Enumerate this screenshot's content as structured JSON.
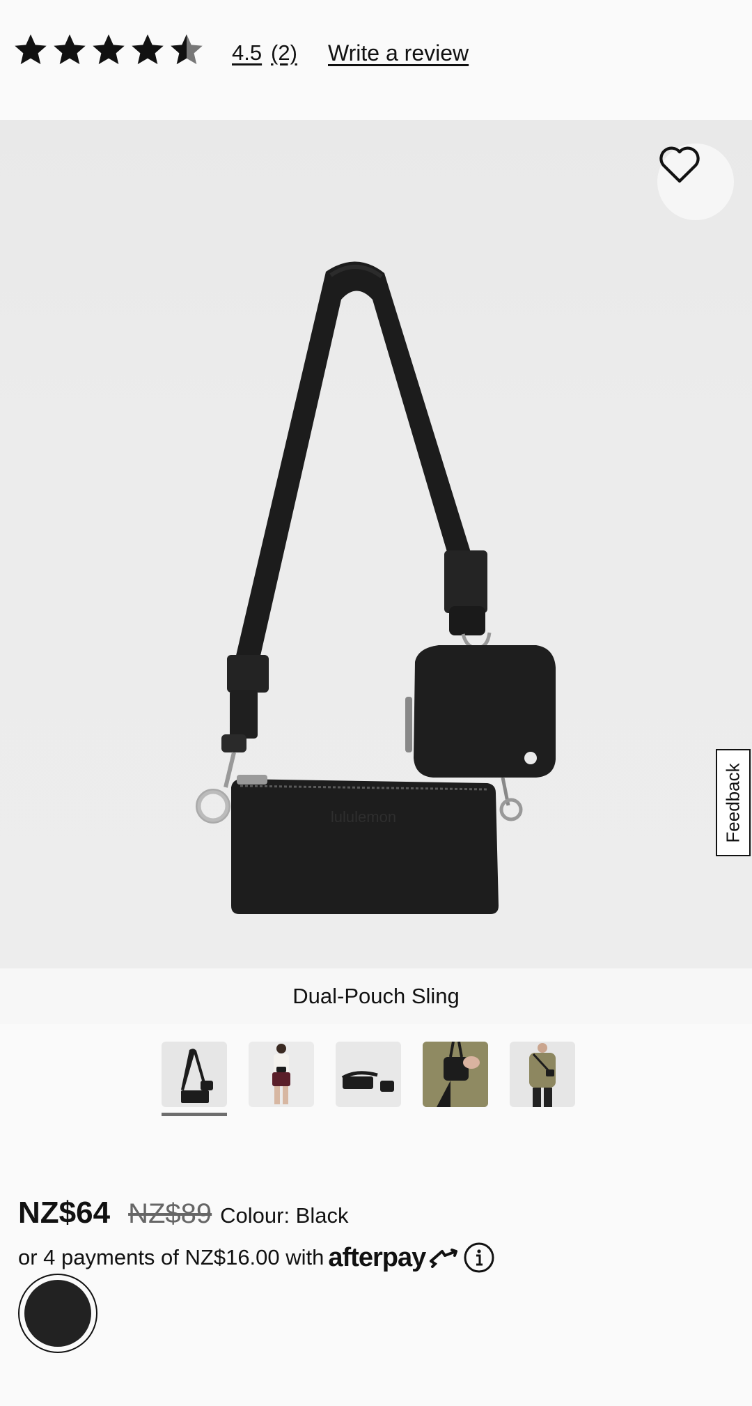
{
  "rating": {
    "value": "4.5",
    "count": "(2)",
    "stars_filled": 4.5,
    "stars_total": 5,
    "write_review": "Write a review"
  },
  "product": {
    "name": "Dual-Pouch Sling",
    "hero_logo_text": "lululemon",
    "thumbnails": [
      "bag-front",
      "model-front",
      "bag-flat",
      "hand-held",
      "model-worn"
    ],
    "selected_thumbnail": 0
  },
  "price": {
    "current": "NZ$64",
    "original": "NZ$89",
    "colour_label": "Colour: Black"
  },
  "afterpay": {
    "text": "or 4 payments of NZ$16.00 with",
    "logo": "afterpay"
  },
  "feedback": {
    "label": "Feedback"
  },
  "swatch": {
    "color": "#222222",
    "name": "Black"
  },
  "colors": {
    "text": "#111111",
    "background": "#fafafa"
  }
}
